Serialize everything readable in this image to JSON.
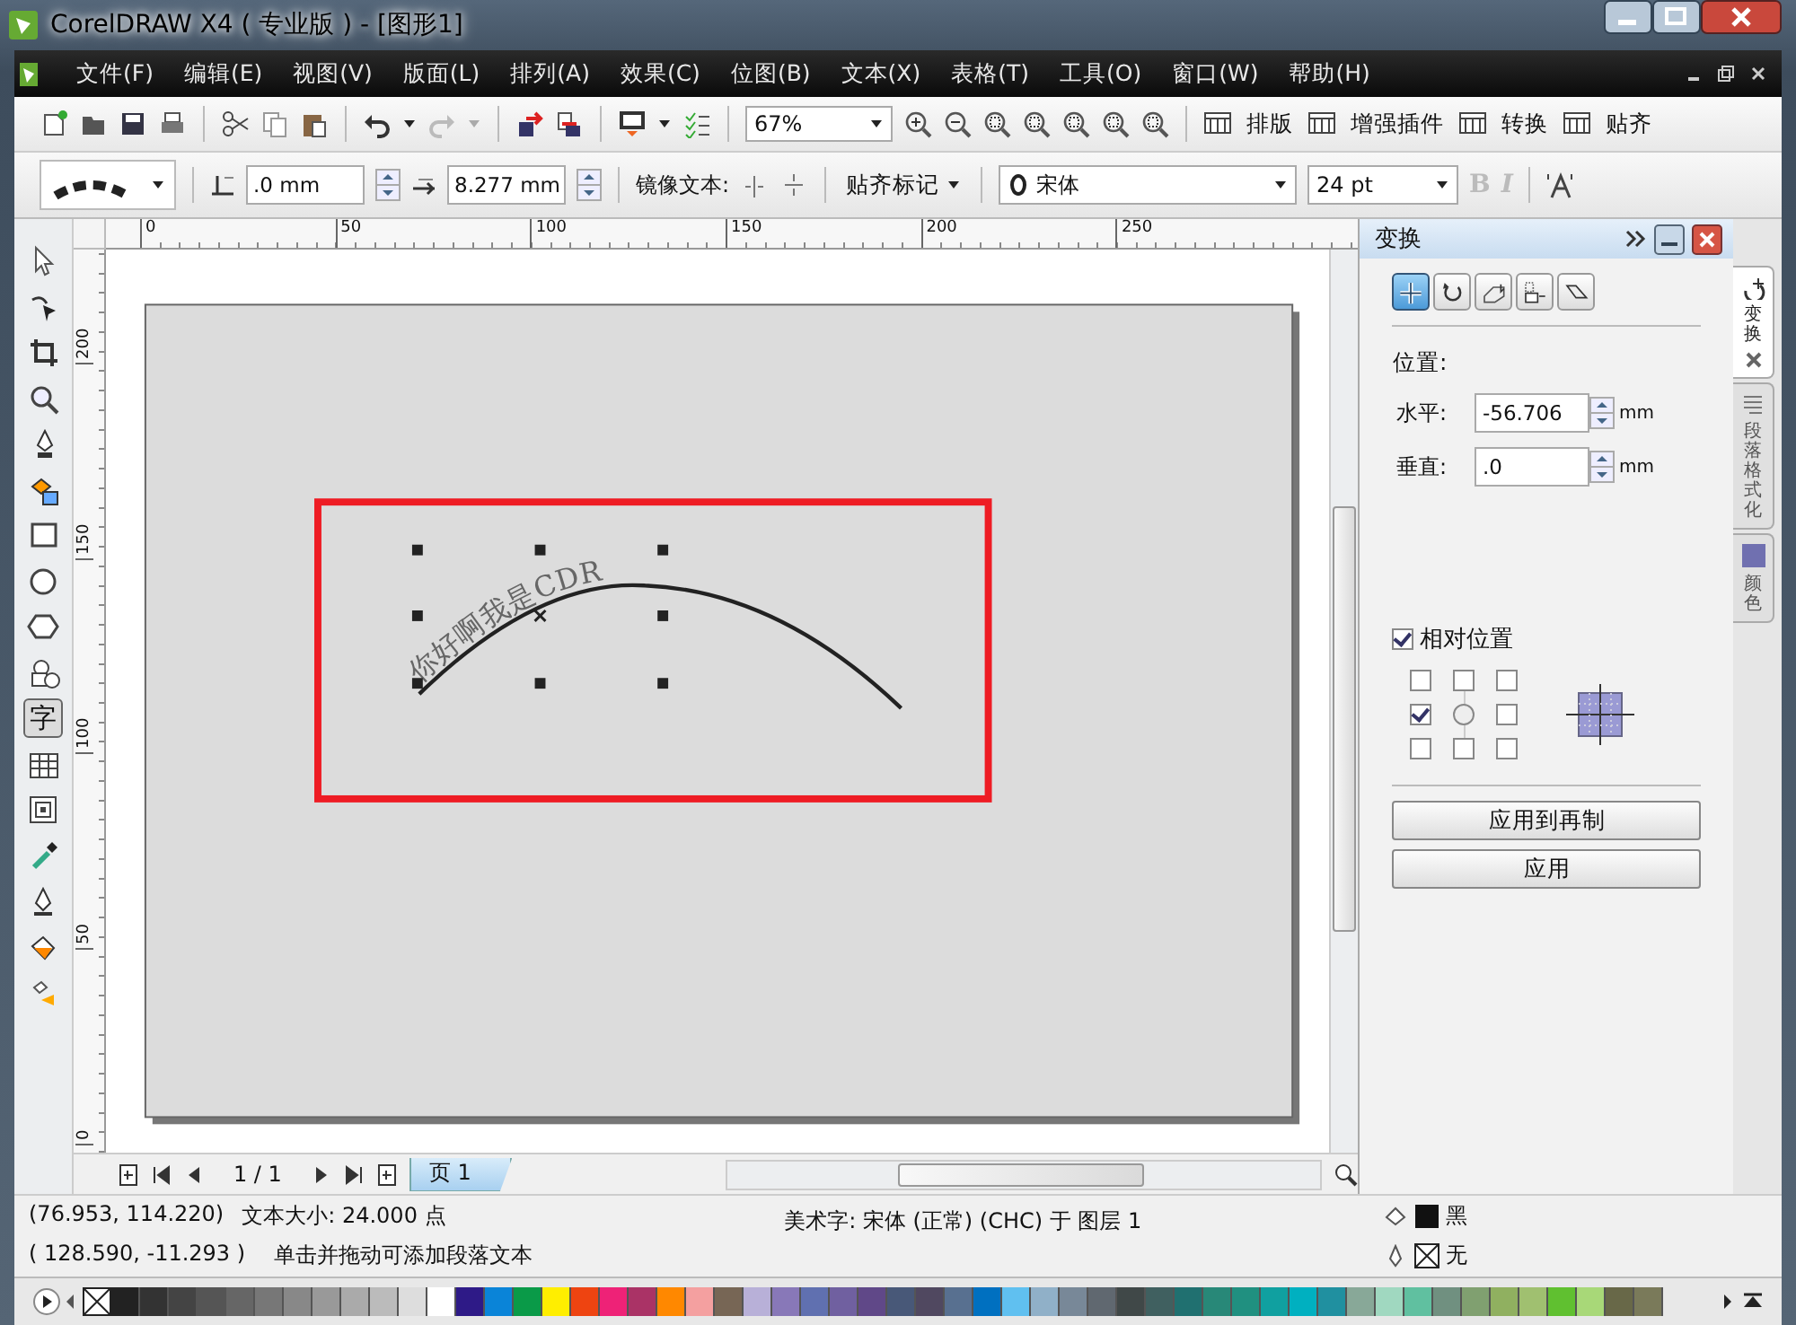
{
  "window": {
    "title": "CorelDRAW X4 ( 专业版 ) - [图形1]"
  },
  "menu": [
    "文件(F)",
    "编辑(E)",
    "视图(V)",
    "版面(L)",
    "排列(A)",
    "效果(C)",
    "位图(B)",
    "文本(X)",
    "表格(T)",
    "工具(O)",
    "窗口(W)",
    "帮助(H)"
  ],
  "toolbar": {
    "zoom": "67%",
    "buttons": [
      {
        "label": "排版"
      },
      {
        "label": "增强插件"
      },
      {
        "label": "转换"
      },
      {
        "label": "贴齐"
      }
    ]
  },
  "property_bar": {
    "offset": ".0 mm",
    "distance": "8.277 mm",
    "mirror_label": "镜像文本:",
    "snap_marks": "贴齐标记",
    "font": "宋体",
    "size": "24 pt",
    "bold": {
      "label": "B",
      "disabled": true
    },
    "italic": {
      "label": "I",
      "disabled": true
    }
  },
  "toolbox": [
    {
      "kind": "pick",
      "selected": false
    },
    {
      "kind": "shape",
      "selected": false
    },
    {
      "kind": "crop",
      "selected": false
    },
    {
      "kind": "zoom",
      "selected": false
    },
    {
      "kind": "freehand",
      "selected": false
    },
    {
      "kind": "smart-fill",
      "selected": false
    },
    {
      "kind": "rectangle",
      "selected": false
    },
    {
      "kind": "ellipse",
      "selected": false
    },
    {
      "kind": "polygon",
      "selected": false
    },
    {
      "kind": "basic-shapes",
      "selected": false
    },
    {
      "kind": "text",
      "label": "字",
      "selected": true
    },
    {
      "kind": "table",
      "selected": false
    },
    {
      "kind": "interactive",
      "selected": false
    },
    {
      "kind": "eyedropper",
      "selected": false
    },
    {
      "kind": "outline",
      "selected": false
    },
    {
      "kind": "fill",
      "selected": false
    },
    {
      "kind": "interactive-fill",
      "selected": false
    }
  ],
  "rulers": {
    "horizontal": [
      "0",
      "50",
      "100",
      "150",
      "200",
      "250"
    ],
    "vertical": [
      "200",
      "150",
      "100",
      "50",
      "0"
    ]
  },
  "canvas": {
    "curve_text": "你好啊我是CDR"
  },
  "page_nav": {
    "page_count": "1 / 1",
    "tabs": [
      {
        "label": "页 1",
        "selected": true
      }
    ]
  },
  "docker": {
    "title": "变换",
    "modes": [
      {
        "kind": "position",
        "selected": true
      },
      {
        "kind": "rotate",
        "selected": false
      },
      {
        "kind": "scale",
        "selected": false
      },
      {
        "kind": "size",
        "selected": false
      },
      {
        "kind": "skew",
        "selected": false
      }
    ],
    "section": "位置:",
    "fields": [
      {
        "label": "水平:",
        "value": "-56.706",
        "unit": "mm"
      },
      {
        "label": "垂直:",
        "value": ".0",
        "unit": "mm"
      }
    ],
    "relative": {
      "label": "相对位置",
      "checked": true
    },
    "anchors": [
      {
        "kind": "box",
        "checked": false
      },
      {
        "kind": "box",
        "checked": false
      },
      {
        "kind": "box",
        "checked": false
      },
      {
        "kind": "box",
        "checked": true
      },
      {
        "kind": "radio",
        "checked": false
      },
      {
        "kind": "box",
        "checked": false
      },
      {
        "kind": "box",
        "checked": false
      },
      {
        "kind": "box",
        "checked": false
      },
      {
        "kind": "box",
        "checked": false
      }
    ],
    "buttons": [
      "应用到再制",
      "应用"
    ]
  },
  "docker_tabs": [
    {
      "label": "变换",
      "selected": true
    },
    {
      "label": "段落格式化",
      "selected": false
    },
    {
      "label": "颜色",
      "selected": false
    }
  ],
  "status": {
    "coords": "(76.953, 114.220)",
    "text_size": "文本大小: 24.000 点",
    "object_info": "美术字: 宋体 (正常) (CHC) 于 图层 1",
    "cursor": "( 128.590, -11.293 )",
    "hint": "单击并拖动可添加段落文本",
    "fill": "黑",
    "outline": "无"
  },
  "palette": [
    {
      "color": "#222222"
    },
    {
      "color": "#333333"
    },
    {
      "color": "#444444"
    },
    {
      "color": "#555555"
    },
    {
      "color": "#666666"
    },
    {
      "color": "#777777"
    },
    {
      "color": "#888888"
    },
    {
      "color": "#999999"
    },
    {
      "color": "#aaaaaa"
    },
    {
      "color": "#bbbbbb"
    },
    {
      "color": "#dddddd"
    },
    {
      "color": "#ffffff"
    },
    {
      "color": "#2e1a87"
    },
    {
      "color": "#0a84d8"
    },
    {
      "color": "#0a9a48"
    },
    {
      "color": "#ffee00"
    },
    {
      "color": "#ee4411"
    },
    {
      "color": "#ee2277"
    },
    {
      "color": "#aa3366"
    },
    {
      "color": "#ff8800"
    },
    {
      "color": "#f4a0a0"
    },
    {
      "color": "#776655"
    },
    {
      "color": "#b8b0d8"
    },
    {
      "color": "#8878b8"
    },
    {
      "color": "#6070b0"
    },
    {
      "color": "#7060a0"
    },
    {
      "color": "#604888"
    },
    {
      "color": "#485878"
    },
    {
      "color": "#504860"
    },
    {
      "color": "#587090"
    },
    {
      "color": "#0070c0"
    },
    {
      "color": "#60c0f0"
    },
    {
      "color": "#90b0c8"
    },
    {
      "color": "#788898"
    },
    {
      "color": "#606870"
    },
    {
      "color": "#404848"
    },
    {
      "color": "#406060"
    },
    {
      "color": "#207070"
    },
    {
      "color": "#288878"
    },
    {
      "color": "#209080"
    },
    {
      "color": "#10a0a0"
    },
    {
      "color": "#00b0c0"
    },
    {
      "color": "#2090a0"
    },
    {
      "color": "#88a898"
    },
    {
      "color": "#a0d8c0"
    },
    {
      "color": "#60c0a0"
    },
    {
      "color": "#709080"
    },
    {
      "color": "#80a070"
    },
    {
      "color": "#90b060"
    },
    {
      "color": "#a0c070"
    },
    {
      "color": "#60c030"
    },
    {
      "color": "#a8d878"
    },
    {
      "color": "#686848"
    },
    {
      "color": "#7a7a5a"
    }
  ]
}
